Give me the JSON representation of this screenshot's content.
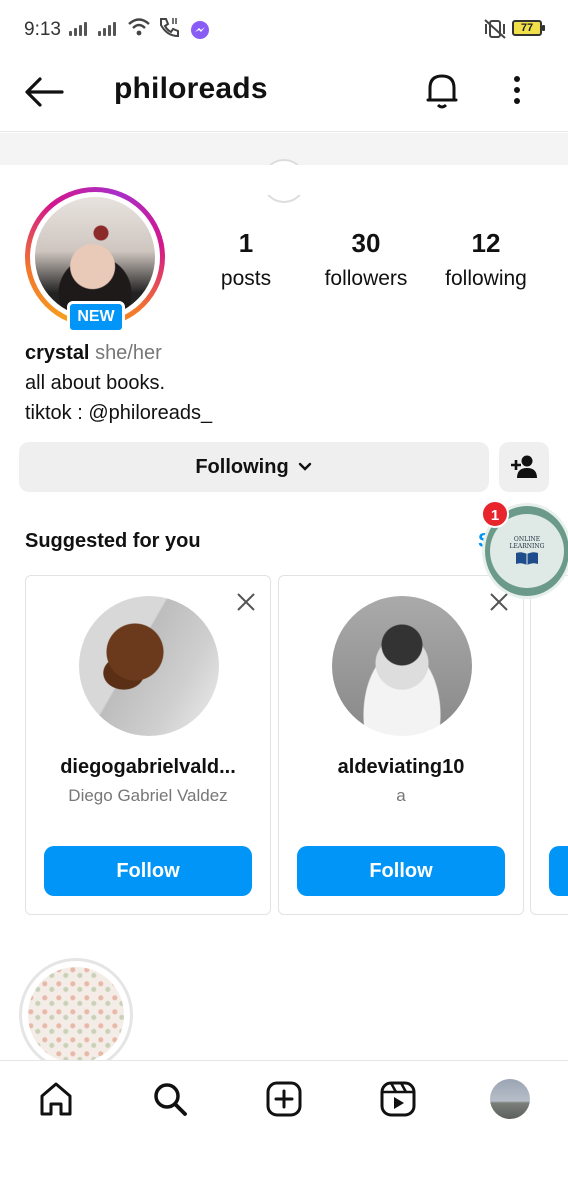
{
  "status_bar": {
    "time": "9:13",
    "battery": "77"
  },
  "header": {
    "username": "philoreads",
    "back_icon": "arrow-left-icon",
    "notifications_icon": "bell-icon",
    "more_icon": "more-vertical-icon"
  },
  "profile": {
    "new_badge": "NEW",
    "stats": [
      {
        "value": "1",
        "label": "posts"
      },
      {
        "value": "30",
        "label": "followers"
      },
      {
        "value": "12",
        "label": "following"
      }
    ],
    "display_name": "crystal",
    "pronouns": "she/her",
    "bio_lines": [
      "all about books.",
      "tiktok : @philoreads_"
    ],
    "following_button": "Following"
  },
  "suggested": {
    "title": "Suggested for you",
    "see_all": "S",
    "cards": [
      {
        "username": "diegogabrielvald...",
        "full_name": "Diego Gabriel Valdez",
        "button": "Follow"
      },
      {
        "username": "aldeviating10",
        "full_name": "a",
        "button": "Follow"
      }
    ]
  },
  "floating_badge": {
    "count": "1",
    "text_top": "ONLINE",
    "text_bottom": "LEARNING"
  },
  "bottom_nav": [
    "home-icon",
    "search-icon",
    "create-icon",
    "reels-icon",
    "profile-avatar"
  ],
  "colors": {
    "accent": "#0095f6",
    "notification": "#e8242c"
  }
}
